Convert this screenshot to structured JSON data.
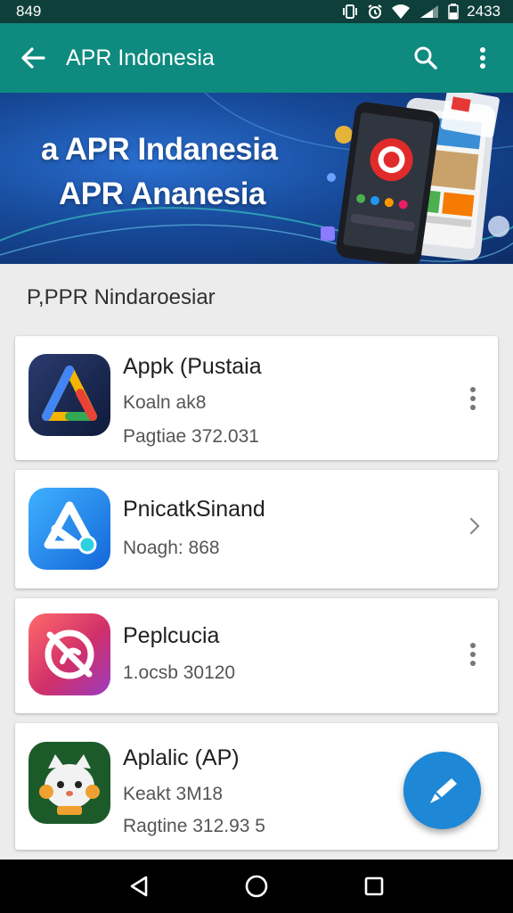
{
  "status_bar": {
    "time_left": "849",
    "time_right": "2433"
  },
  "app_bar": {
    "title": "APR Indonesia"
  },
  "banner": {
    "line1": "a APR Indanesia",
    "line2": "APR Ananesia"
  },
  "section": {
    "title": "P,PPR Nindaroesiar"
  },
  "apps": [
    {
      "name": "Appk (Pustaia",
      "meta1": "Koaln ak8",
      "meta2": "Pagtiae 372.031",
      "action": "more-vert-icon"
    },
    {
      "name": "PnicatkSinand",
      "meta1": "Noagh: 868",
      "action": "chevron-right-icon"
    },
    {
      "name": "Peplcucia",
      "meta1": "1.ocsb 30120",
      "action": "more-vert-icon"
    },
    {
      "name": "Aplalic (AP)",
      "meta1": "Keakt 3M18",
      "meta2": "Ragtine 312.93 5"
    }
  ],
  "colors": {
    "status_bar": "#0e3f3a",
    "app_bar": "#0f8a7f",
    "fab": "#1e87d6",
    "nav_bar": "#000000"
  },
  "icons": [
    "back-arrow-icon",
    "search-icon",
    "more-vert-icon",
    "edit-icon",
    "nav-back-icon",
    "nav-home-icon",
    "nav-recents-icon"
  ]
}
